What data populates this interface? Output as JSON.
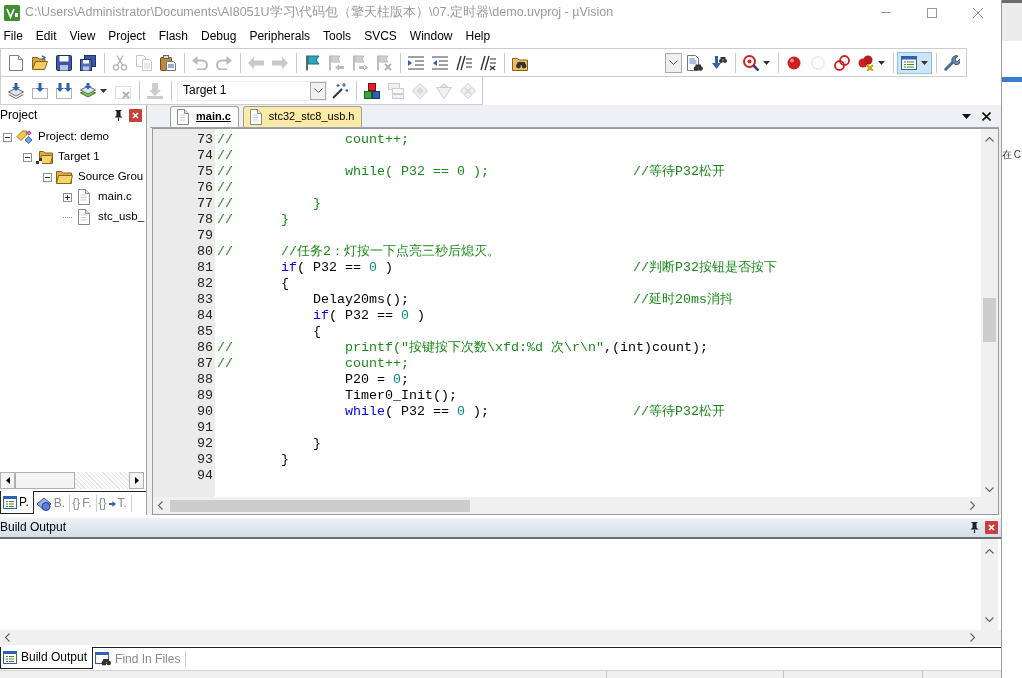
{
  "window": {
    "title": "C:\\Users\\Administrator\\Documents\\AI8051U学习\\代码包（擎天柱版本）\\07.定时器\\demo.uvproj - µVision"
  },
  "menu": [
    "File",
    "Edit",
    "View",
    "Project",
    "Flash",
    "Debug",
    "Peripherals",
    "Tools",
    "SVCS",
    "Window",
    "Help"
  ],
  "toolbar_1": [
    {
      "disabled": false,
      "pressed": false
    },
    {
      "disabled": false,
      "pressed": false
    },
    {
      "disabled": false,
      "pressed": false
    },
    {
      "disabled": false,
      "pressed": false
    },
    {
      "disabled": true,
      "pressed": false
    },
    {
      "disabled": true,
      "pressed": false
    },
    {
      "disabled": false,
      "pressed": false
    },
    {
      "disabled": true,
      "pressed": false
    },
    {
      "disabled": true,
      "pressed": false
    },
    {
      "disabled": true,
      "pressed": false
    },
    {
      "disabled": true,
      "pressed": false
    },
    {
      "disabled": false,
      "pressed": false
    },
    {
      "disabled": true,
      "pressed": false
    },
    {
      "disabled": true,
      "pressed": false
    },
    {
      "disabled": true,
      "pressed": false
    },
    {
      "disabled": false,
      "pressed": false
    },
    {
      "disabled": false,
      "pressed": false
    },
    {
      "disabled": false,
      "pressed": false
    },
    {
      "disabled": false,
      "pressed": false
    },
    {
      "disabled": false,
      "pressed": false
    },
    {
      "disabled": false,
      "pressed": false
    },
    {
      "disabled": false,
      "pressed": false
    },
    {
      "disabled": false,
      "pressed": false
    },
    {
      "disabled": false,
      "pressed": false
    },
    {
      "disabled": true,
      "pressed": false
    },
    {
      "disabled": false,
      "pressed": false
    },
    {
      "disabled": false,
      "pressed": false
    },
    {
      "disabled": false,
      "pressed": true
    },
    {
      "disabled": false,
      "pressed": false
    }
  ],
  "toolbar_2": [
    {
      "disabled": false,
      "pressed": false
    },
    {
      "disabled": false,
      "pressed": false
    },
    {
      "disabled": false,
      "pressed": false
    },
    {
      "disabled": false,
      "pressed": false
    },
    {
      "disabled": true,
      "pressed": false
    },
    {
      "disabled": true,
      "pressed": false
    },
    {
      "disabled": false,
      "pressed": false
    },
    {
      "disabled": false,
      "pressed": false
    },
    {
      "disabled": true,
      "pressed": false
    },
    {
      "disabled": true,
      "pressed": false
    },
    {
      "disabled": true,
      "pressed": false
    },
    {
      "disabled": true,
      "pressed": false
    }
  ],
  "target_select": {
    "value": "Target 1"
  },
  "project_panel": {
    "title": "Project",
    "tree": [
      {
        "label": "Project: demo",
        "kind": "project",
        "expanded": true,
        "children": [
          {
            "label": "Target 1",
            "kind": "target",
            "expanded": true,
            "children": [
              {
                "label": "Source Grou",
                "kind": "group",
                "expanded": true,
                "children": [
                  {
                    "label": "main.c",
                    "kind": "file",
                    "expanded": false
                  },
                  {
                    "label": "stc_usb_",
                    "kind": "file"
                  }
                ]
              }
            ]
          }
        ]
      }
    ],
    "tabs": [
      {
        "label": "P.",
        "kind": "project",
        "selected": true
      },
      {
        "label": "B.",
        "kind": "books",
        "selected": false
      },
      {
        "label": "F.",
        "kind": "functions",
        "glyph": "{}",
        "selected": false
      },
      {
        "label": "T.",
        "kind": "templates",
        "glyph": "{}",
        "selected": false
      }
    ]
  },
  "editor": {
    "tabs": [
      {
        "label": "main.c",
        "selected": true
      },
      {
        "label": "stc32_stc8_usb.h",
        "selected": false
      }
    ],
    "lines": [
      {
        "number": "73",
        "segments": [
          {
            "kind": "comment",
            "text": "//              count++;"
          }
        ]
      },
      {
        "number": "74",
        "segments": [
          {
            "kind": "comment",
            "text": "//"
          }
        ]
      },
      {
        "number": "75",
        "segments": [
          {
            "kind": "comment",
            "text": "//              while( P32 == 0 );                  //等待P32松开"
          }
        ]
      },
      {
        "number": "76",
        "segments": [
          {
            "kind": "comment",
            "text": "//"
          }
        ]
      },
      {
        "number": "77",
        "segments": [
          {
            "kind": "comment",
            "text": "//          }"
          }
        ]
      },
      {
        "number": "78",
        "segments": [
          {
            "kind": "comment",
            "text": "//      }"
          }
        ]
      },
      {
        "number": "79"
      },
      {
        "number": "80",
        "segments": [
          {
            "kind": "comment",
            "text": "//      //任务2：灯按一下点亮三秒后熄灭。"
          }
        ]
      },
      {
        "number": "81",
        "segments": [
          {
            "kind": "keyword",
            "text": "        if"
          },
          {
            "kind": "plain",
            "text": "( P32 == "
          },
          {
            "kind": "number",
            "text": "0"
          },
          {
            "kind": "plain",
            "text": " )"
          },
          {
            "kind": "comment",
            "text": "                              //判断P32按钮是否按下"
          }
        ]
      },
      {
        "number": "82",
        "segments": [
          {
            "kind": "plain",
            "text": "        {"
          }
        ]
      },
      {
        "number": "83",
        "segments": [
          {
            "kind": "plain",
            "text": "            Delay20ms();"
          },
          {
            "kind": "comment",
            "text": "                            //延时20ms消抖"
          }
        ]
      },
      {
        "number": "84",
        "segments": [
          {
            "kind": "keyword",
            "text": "            if"
          },
          {
            "kind": "plain",
            "text": "( P32 == "
          },
          {
            "kind": "number",
            "text": "0"
          },
          {
            "kind": "plain",
            "text": " )"
          }
        ]
      },
      {
        "number": "85",
        "segments": [
          {
            "kind": "plain",
            "text": "            {"
          }
        ]
      },
      {
        "number": "86",
        "segments": [
          {
            "kind": "comment",
            "text": "//              printf(\"按键按下次数\\xfd:%d 次\\r\\n\""
          },
          {
            "kind": "plain",
            "text": ",(int)count);"
          }
        ]
      },
      {
        "number": "87",
        "segments": [
          {
            "kind": "comment",
            "text": "//              count++;"
          }
        ]
      },
      {
        "number": "88",
        "segments": [
          {
            "kind": "plain",
            "text": "                P20 = "
          },
          {
            "kind": "number",
            "text": "0"
          },
          {
            "kind": "plain",
            "text": ";"
          }
        ]
      },
      {
        "number": "89",
        "segments": [
          {
            "kind": "plain",
            "text": "                Timer0_Init();"
          }
        ]
      },
      {
        "number": "90",
        "segments": [
          {
            "kind": "keyword",
            "text": "                while"
          },
          {
            "kind": "plain",
            "text": "( P32 == "
          },
          {
            "kind": "number",
            "text": "0"
          },
          {
            "kind": "plain",
            "text": " );"
          },
          {
            "kind": "comment",
            "text": "                  //等待P32松开"
          }
        ]
      },
      {
        "number": "91"
      },
      {
        "number": "92",
        "segments": [
          {
            "kind": "plain",
            "text": "            }"
          }
        ]
      },
      {
        "number": "93",
        "segments": [
          {
            "kind": "plain",
            "text": "        }"
          }
        ]
      },
      {
        "number": "94"
      }
    ]
  },
  "build_output": {
    "title": "Build Output"
  },
  "bottom_tabs": [
    {
      "label": "Build Output",
      "kind": "build",
      "selected": true
    },
    {
      "label": "Find In Files",
      "kind": "find",
      "selected": false
    }
  ],
  "background_window": {
    "text": "在 C"
  }
}
